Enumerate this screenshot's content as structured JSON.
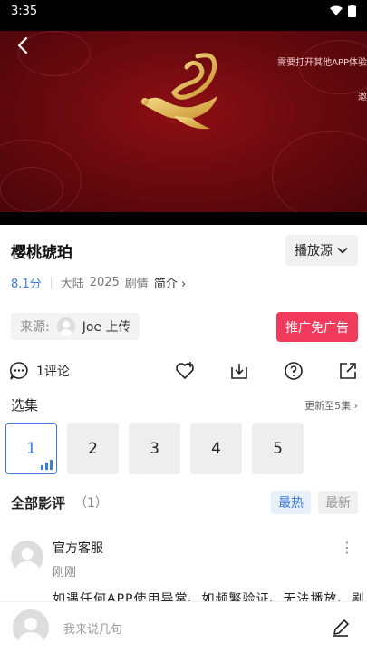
{
  "status_bar": {
    "time": "3:35"
  },
  "player": {
    "notice": "需要打开其他APP体验",
    "notice2": "邀"
  },
  "title": "樱桃琥珀",
  "source_button": "播放源",
  "meta": {
    "score": "8.1分",
    "region": "大陆",
    "year": "2025",
    "genre": "剧情",
    "intro": "简介"
  },
  "uploader": {
    "label": "来源:",
    "name": "Joe 上传"
  },
  "promo_button": "推广免广告",
  "actions": {
    "comments": "1评论"
  },
  "episodes": {
    "title": "选集",
    "update": "更新至5集",
    "items": [
      "1",
      "2",
      "3",
      "4",
      "5"
    ]
  },
  "comments_section": {
    "title": "全部影评",
    "count": "（1）",
    "sort_hot": "最热",
    "sort_new": "最新"
  },
  "comment": {
    "name": "官方客服",
    "time": "刚刚",
    "text": "如遇任何APP使用异常、如频繁验证、无法播放、剧"
  },
  "bottom": {
    "placeholder": "我来说几句"
  },
  "colors": {
    "accent": "#3b7ddd",
    "promo": "#f23a5c",
    "video_bg": "#6c0a10"
  }
}
